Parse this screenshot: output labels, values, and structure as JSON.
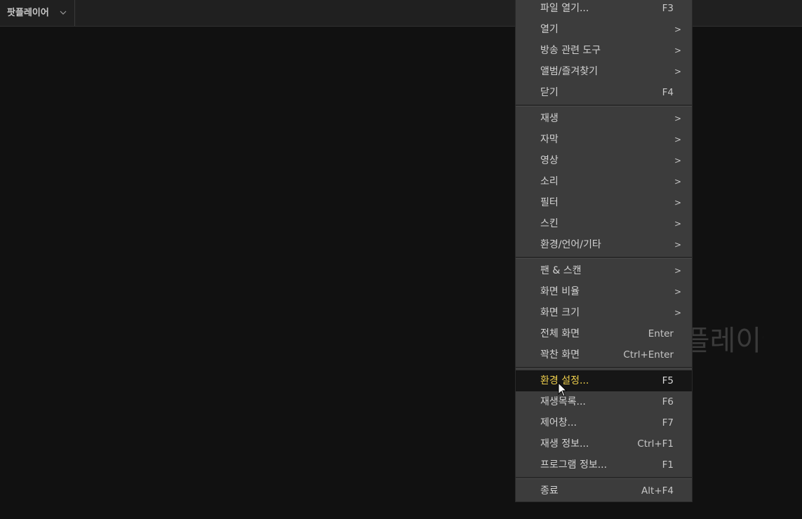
{
  "titlebar": {
    "app_menu_label": "팟플레이어"
  },
  "video": {
    "watermark_text": "팟플레이어"
  },
  "context_menu": {
    "groups": [
      [
        {
          "label": "파일 열기...",
          "shortcut": "F3",
          "submenu": false
        },
        {
          "label": "열기",
          "shortcut": ">",
          "submenu": true
        },
        {
          "label": "방송 관련 도구",
          "shortcut": ">",
          "submenu": true
        },
        {
          "label": "앨범/즐겨찾기",
          "shortcut": ">",
          "submenu": true
        },
        {
          "label": "닫기",
          "shortcut": "F4",
          "submenu": false
        }
      ],
      [
        {
          "label": "재생",
          "shortcut": ">",
          "submenu": true
        },
        {
          "label": "자막",
          "shortcut": ">",
          "submenu": true
        },
        {
          "label": "영상",
          "shortcut": ">",
          "submenu": true
        },
        {
          "label": "소리",
          "shortcut": ">",
          "submenu": true
        },
        {
          "label": "필터",
          "shortcut": ">",
          "submenu": true
        },
        {
          "label": "스킨",
          "shortcut": ">",
          "submenu": true
        },
        {
          "label": "환경/언어/기타",
          "shortcut": ">",
          "submenu": true
        }
      ],
      [
        {
          "label": "팬 & 스캔",
          "shortcut": ">",
          "submenu": true
        },
        {
          "label": "화면 비율",
          "shortcut": ">",
          "submenu": true
        },
        {
          "label": "화면 크기",
          "shortcut": ">",
          "submenu": true
        },
        {
          "label": "전체 화면",
          "shortcut": "Enter",
          "submenu": false
        },
        {
          "label": "꽉찬 화면",
          "shortcut": "Ctrl+Enter",
          "submenu": false
        }
      ],
      [
        {
          "label": "환경 설정...",
          "shortcut": "F5",
          "submenu": false,
          "highlighted": true
        },
        {
          "label": "재생목록...",
          "shortcut": "F6",
          "submenu": false
        },
        {
          "label": "제어창...",
          "shortcut": "F7",
          "submenu": false
        },
        {
          "label": "재생 정보...",
          "shortcut": "Ctrl+F1",
          "submenu": false
        },
        {
          "label": "프로그램 정보...",
          "shortcut": "F1",
          "submenu": false
        }
      ],
      [
        {
          "label": "종료",
          "shortcut": "Alt+F4",
          "submenu": false
        }
      ]
    ]
  },
  "colors": {
    "background": "#111111",
    "titlebar": "#202020",
    "menu_background": "#3c3c3c",
    "menu_highlight": "#161616",
    "highlight_text": "#f0d04c",
    "menu_text": "#d2d2d2"
  },
  "icons": {
    "app_menu_dropdown": "chevron-down-icon",
    "submenu": "chevron-right-icon",
    "pointer": "mouse-cursor-icon"
  }
}
